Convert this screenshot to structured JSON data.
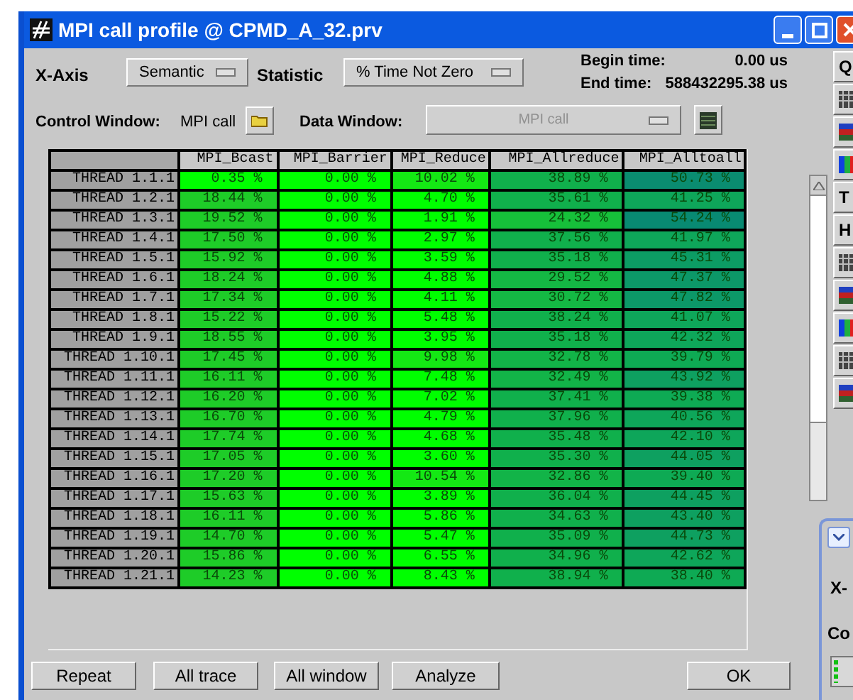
{
  "window": {
    "title": "MPI call profile @ CPMD_A_32.prv"
  },
  "controls": {
    "x_axis_label": "X-Axis",
    "x_axis_value": "Semantic",
    "statistic_label": "Statistic",
    "statistic_value": "% Time Not Zero",
    "begin_label": "Begin time:",
    "begin_value": "0.00 us",
    "end_label": "End time:",
    "end_value": "588432295.38 us",
    "control_window_label": "Control Window:",
    "control_window_value": "MPI call",
    "data_window_label": "Data Window:",
    "data_window_value": "MPI call",
    "data_window_disabled": true
  },
  "table": {
    "columns": [
      "MPI_Bcast",
      "MPI_Barrier",
      "MPI_Reduce",
      "MPI_Allreduce",
      "MPI_Alltoall"
    ],
    "rows": [
      {
        "label": "THREAD 1.1.1",
        "cells": [
          {
            "text": "0.35 %",
            "color": "#00ff00"
          },
          {
            "text": "0.00 %",
            "color": "#00ff00"
          },
          {
            "text": "10.02 %",
            "color": "#14e814"
          },
          {
            "text": "38.89 %",
            "color": "#10b04c"
          },
          {
            "text": "50.73 %",
            "color": "#0a8c70"
          }
        ]
      },
      {
        "label": "THREAD 1.2.1",
        "cells": [
          {
            "text": "18.44 %",
            "color": "#1ecc28"
          },
          {
            "text": "0.00 %",
            "color": "#00ff00"
          },
          {
            "text": "4.70 %",
            "color": "#00ff00"
          },
          {
            "text": "35.61 %",
            "color": "#10b04c"
          },
          {
            "text": "41.25 %",
            "color": "#0ea65a"
          }
        ]
      },
      {
        "label": "THREAD 1.3.1",
        "cells": [
          {
            "text": "19.52 %",
            "color": "#1ecc28"
          },
          {
            "text": "0.00 %",
            "color": "#00ff00"
          },
          {
            "text": "1.91 %",
            "color": "#00ff00"
          },
          {
            "text": "24.32 %",
            "color": "#16c03a"
          },
          {
            "text": "54.24 %",
            "color": "#088a72"
          }
        ]
      },
      {
        "label": "THREAD 1.4.1",
        "cells": [
          {
            "text": "17.50 %",
            "color": "#1ecc28"
          },
          {
            "text": "0.00 %",
            "color": "#00ff00"
          },
          {
            "text": "2.97 %",
            "color": "#00ff00"
          },
          {
            "text": "37.56 %",
            "color": "#10b04c"
          },
          {
            "text": "41.97 %",
            "color": "#0ea65a"
          }
        ]
      },
      {
        "label": "THREAD 1.5.1",
        "cells": [
          {
            "text": "15.92 %",
            "color": "#1ecc28"
          },
          {
            "text": "0.00 %",
            "color": "#00ff00"
          },
          {
            "text": "3.59 %",
            "color": "#00ff00"
          },
          {
            "text": "35.18 %",
            "color": "#10b04c"
          },
          {
            "text": "45.31 %",
            "color": "#0c9c64"
          }
        ]
      },
      {
        "label": "THREAD 1.6.1",
        "cells": [
          {
            "text": "18.24 %",
            "color": "#1ecc28"
          },
          {
            "text": "0.00 %",
            "color": "#00ff00"
          },
          {
            "text": "4.88 %",
            "color": "#00ff00"
          },
          {
            "text": "29.52 %",
            "color": "#14b844"
          },
          {
            "text": "47.37 %",
            "color": "#0c9868"
          }
        ]
      },
      {
        "label": "THREAD 1.7.1",
        "cells": [
          {
            "text": "17.34 %",
            "color": "#1ecc28"
          },
          {
            "text": "0.00 %",
            "color": "#00ff00"
          },
          {
            "text": "4.11 %",
            "color": "#00ff00"
          },
          {
            "text": "30.72 %",
            "color": "#14b844"
          },
          {
            "text": "47.82 %",
            "color": "#0c9868"
          }
        ]
      },
      {
        "label": "THREAD 1.8.1",
        "cells": [
          {
            "text": "15.22 %",
            "color": "#1ecc28"
          },
          {
            "text": "0.00 %",
            "color": "#00ff00"
          },
          {
            "text": "5.48 %",
            "color": "#00ff00"
          },
          {
            "text": "38.24 %",
            "color": "#10b04c"
          },
          {
            "text": "41.07 %",
            "color": "#0ea65a"
          }
        ]
      },
      {
        "label": "THREAD 1.9.1",
        "cells": [
          {
            "text": "18.55 %",
            "color": "#1ecc28"
          },
          {
            "text": "0.00 %",
            "color": "#00ff00"
          },
          {
            "text": "3.95 %",
            "color": "#00ff00"
          },
          {
            "text": "35.18 %",
            "color": "#10b04c"
          },
          {
            "text": "42.32 %",
            "color": "#0ea65a"
          }
        ]
      },
      {
        "label": "THREAD 1.10.1",
        "cells": [
          {
            "text": "17.45 %",
            "color": "#1ecc28"
          },
          {
            "text": "0.00 %",
            "color": "#00ff00"
          },
          {
            "text": "9.98 %",
            "color": "#14e814"
          },
          {
            "text": "32.78 %",
            "color": "#12b448"
          },
          {
            "text": "39.79 %",
            "color": "#0eaa54"
          }
        ]
      },
      {
        "label": "THREAD 1.11.1",
        "cells": [
          {
            "text": "16.11 %",
            "color": "#1ecc28"
          },
          {
            "text": "0.00 %",
            "color": "#00ff00"
          },
          {
            "text": "7.48 %",
            "color": "#00ff00"
          },
          {
            "text": "32.49 %",
            "color": "#12b448"
          },
          {
            "text": "43.92 %",
            "color": "#0ea060"
          }
        ]
      },
      {
        "label": "THREAD 1.12.1",
        "cells": [
          {
            "text": "16.20 %",
            "color": "#1ecc28"
          },
          {
            "text": "0.00 %",
            "color": "#00ff00"
          },
          {
            "text": "7.02 %",
            "color": "#00ff00"
          },
          {
            "text": "37.41 %",
            "color": "#10b04c"
          },
          {
            "text": "39.38 %",
            "color": "#0eaa54"
          }
        ]
      },
      {
        "label": "THREAD 1.13.1",
        "cells": [
          {
            "text": "16.70 %",
            "color": "#1ecc28"
          },
          {
            "text": "0.00 %",
            "color": "#00ff00"
          },
          {
            "text": "4.79 %",
            "color": "#00ff00"
          },
          {
            "text": "37.96 %",
            "color": "#10b04c"
          },
          {
            "text": "40.56 %",
            "color": "#0ea65a"
          }
        ]
      },
      {
        "label": "THREAD 1.14.1",
        "cells": [
          {
            "text": "17.74 %",
            "color": "#1ecc28"
          },
          {
            "text": "0.00 %",
            "color": "#00ff00"
          },
          {
            "text": "4.68 %",
            "color": "#00ff00"
          },
          {
            "text": "35.48 %",
            "color": "#10b04c"
          },
          {
            "text": "42.10 %",
            "color": "#0ea65a"
          }
        ]
      },
      {
        "label": "THREAD 1.15.1",
        "cells": [
          {
            "text": "17.05 %",
            "color": "#1ecc28"
          },
          {
            "text": "0.00 %",
            "color": "#00ff00"
          },
          {
            "text": "3.60 %",
            "color": "#00ff00"
          },
          {
            "text": "35.30 %",
            "color": "#10b04c"
          },
          {
            "text": "44.05 %",
            "color": "#0ea060"
          }
        ]
      },
      {
        "label": "THREAD 1.16.1",
        "cells": [
          {
            "text": "17.20 %",
            "color": "#1ecc28"
          },
          {
            "text": "0.00 %",
            "color": "#00ff00"
          },
          {
            "text": "10.54 %",
            "color": "#14e814"
          },
          {
            "text": "32.86 %",
            "color": "#12b448"
          },
          {
            "text": "39.40 %",
            "color": "#0eaa54"
          }
        ]
      },
      {
        "label": "THREAD 1.17.1",
        "cells": [
          {
            "text": "15.63 %",
            "color": "#1ecc28"
          },
          {
            "text": "0.00 %",
            "color": "#00ff00"
          },
          {
            "text": "3.89 %",
            "color": "#00ff00"
          },
          {
            "text": "36.04 %",
            "color": "#10b04c"
          },
          {
            "text": "44.45 %",
            "color": "#0ea060"
          }
        ]
      },
      {
        "label": "THREAD 1.18.1",
        "cells": [
          {
            "text": "16.11 %",
            "color": "#1ecc28"
          },
          {
            "text": "0.00 %",
            "color": "#00ff00"
          },
          {
            "text": "5.86 %",
            "color": "#00ff00"
          },
          {
            "text": "34.63 %",
            "color": "#10b04c"
          },
          {
            "text": "43.40 %",
            "color": "#0ea060"
          }
        ]
      },
      {
        "label": "THREAD 1.19.1",
        "cells": [
          {
            "text": "14.70 %",
            "color": "#1ecc28"
          },
          {
            "text": "0.00 %",
            "color": "#00ff00"
          },
          {
            "text": "5.47 %",
            "color": "#00ff00"
          },
          {
            "text": "35.09 %",
            "color": "#10b04c"
          },
          {
            "text": "44.73 %",
            "color": "#0ea060"
          }
        ]
      },
      {
        "label": "THREAD 1.20.1",
        "cells": [
          {
            "text": "15.86 %",
            "color": "#1ecc28"
          },
          {
            "text": "0.00 %",
            "color": "#00ff00"
          },
          {
            "text": "6.55 %",
            "color": "#00ff00"
          },
          {
            "text": "34.96 %",
            "color": "#10b04c"
          },
          {
            "text": "42.62 %",
            "color": "#0ea65a"
          }
        ]
      },
      {
        "label": "THREAD 1.21.1",
        "cells": [
          {
            "text": "14.23 %",
            "color": "#1ecc28"
          },
          {
            "text": "0.00 %",
            "color": "#00ff00"
          },
          {
            "text": "8.43 %",
            "color": "#00ff00"
          },
          {
            "text": "38.94 %",
            "color": "#10b04c"
          },
          {
            "text": "38.40 %",
            "color": "#0eaa54"
          }
        ]
      }
    ]
  },
  "toolbar": [
    {
      "kind": "text",
      "label": "Q"
    },
    {
      "kind": "icon"
    },
    {
      "kind": "icon"
    },
    {
      "kind": "icon"
    },
    {
      "kind": "text",
      "label": "T"
    },
    {
      "kind": "text",
      "label": "H"
    },
    {
      "kind": "icon"
    },
    {
      "kind": "icon"
    },
    {
      "kind": "icon"
    },
    {
      "kind": "icon"
    },
    {
      "kind": "icon"
    }
  ],
  "buttons": [
    "Repeat",
    "All trace",
    "All window",
    "Analyze",
    "OK"
  ],
  "second_window": {
    "texts": [
      "X-",
      "Co"
    ]
  }
}
